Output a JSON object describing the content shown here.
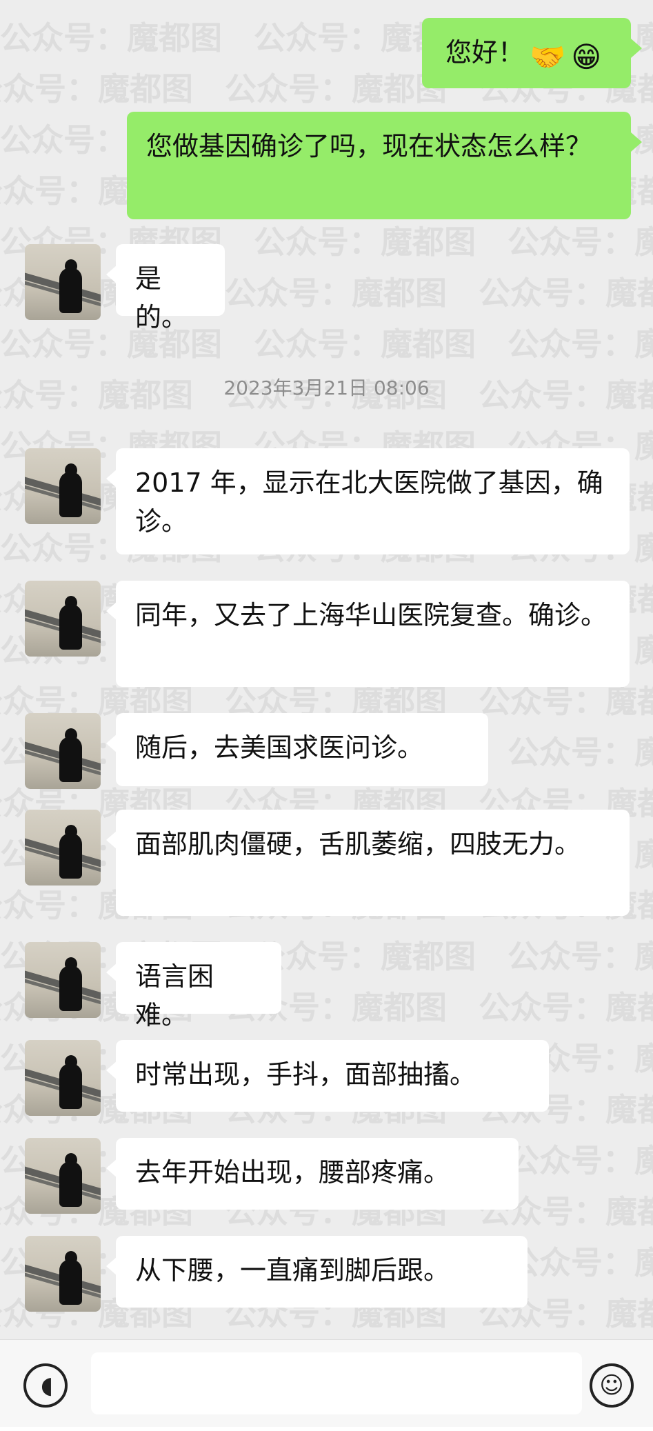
{
  "watermark": {
    "text": "公众号：魔都图"
  },
  "conversation": {
    "outgoing": [
      {
        "text": "您好！",
        "emojis": [
          "handshake-emoji",
          "grinning-emoji"
        ]
      },
      {
        "text": "您做基因确诊了吗，现在状态怎么样？"
      }
    ],
    "timestamp": "2023年3月21日 08:06",
    "incoming": [
      "是的。",
      "2017 年，显示在北大医院做了基因，确诊。",
      "同年，又去了上海华山医院复查。确诊。",
      "随后，去美国求医问诊。",
      "面部肌肉僵硬，舌肌萎缩，四肢无力。",
      "语言困难。",
      "时常出现，手抖，面部抽搐。",
      "去年开始出现，腰部疼痛。",
      "从下腰，一直痛到脚后跟。"
    ]
  },
  "input_bar": {
    "voice_icon": "voice-icon",
    "emoji_icon": "emoji-icon"
  }
}
